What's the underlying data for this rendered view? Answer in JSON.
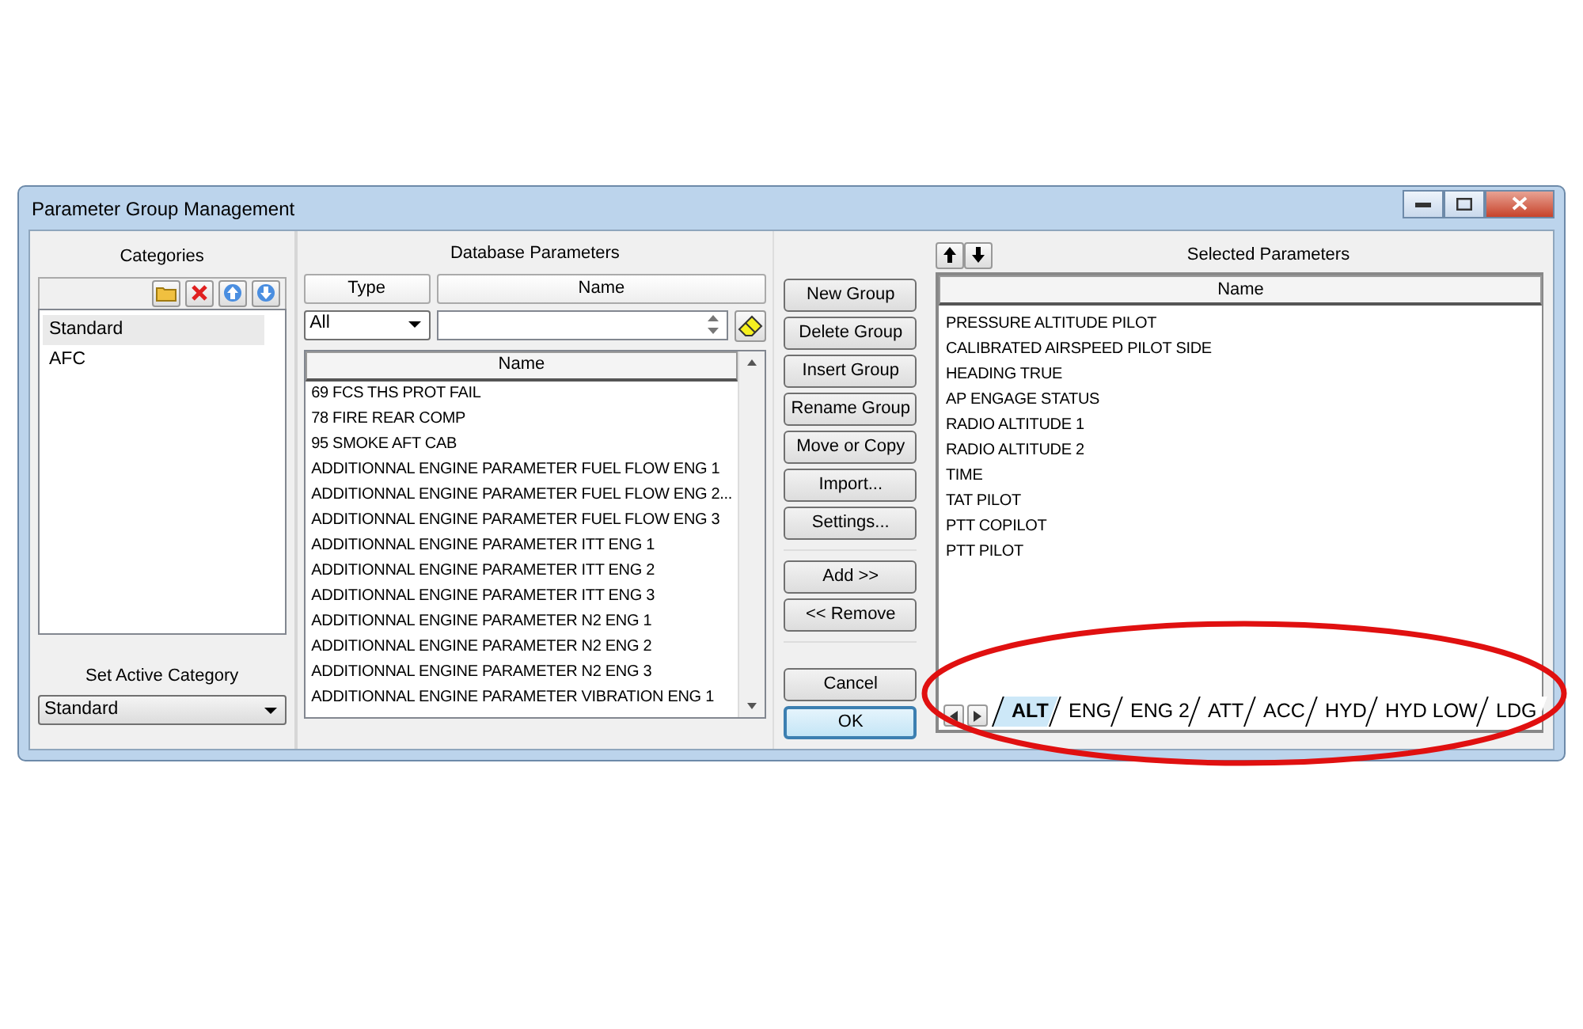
{
  "window": {
    "title": "Parameter Group Management"
  },
  "categories": {
    "title": "Categories",
    "items": [
      {
        "label": "Standard",
        "selected": true
      },
      {
        "label": "AFC",
        "selected": false
      }
    ],
    "active_label": "Set Active Category",
    "active_value": "Standard"
  },
  "database": {
    "title": "Database Parameters",
    "type_header": "Type",
    "type_value": "All",
    "name_header": "Name",
    "list_header": "Name",
    "rows": [
      "69 FCS THS PROT FAIL",
      "78 FIRE REAR COMP",
      "95 SMOKE AFT CAB",
      "ADDITIONNAL ENGINE PARAMETER FUEL FLOW ENG 1",
      "ADDITIONNAL ENGINE PARAMETER FUEL FLOW ENG 2...",
      "ADDITIONNAL ENGINE PARAMETER FUEL FLOW ENG 3",
      "ADDITIONNAL ENGINE PARAMETER ITT ENG 1",
      "ADDITIONNAL ENGINE PARAMETER ITT ENG 2",
      "ADDITIONNAL ENGINE PARAMETER ITT ENG 3",
      "ADDITIONNAL ENGINE PARAMETER N2 ENG 1",
      "ADDITIONNAL ENGINE PARAMETER N2 ENG 2",
      "ADDITIONNAL ENGINE PARAMETER N2 ENG 3",
      "ADDITIONNAL ENGINE PARAMETER VIBRATION ENG 1"
    ]
  },
  "action_groups": [
    [
      {
        "label": "New Group",
        "default": false
      },
      {
        "label": "Delete Group",
        "default": false
      },
      {
        "label": "Insert Group",
        "default": false
      },
      {
        "label": "Rename Group",
        "default": false
      },
      {
        "label": "Move or Copy",
        "default": false
      },
      {
        "label": "Import...",
        "default": false
      },
      {
        "label": "Settings...",
        "default": false
      }
    ],
    [
      {
        "label": "Add  >>",
        "default": false
      },
      {
        "label": "<<  Remove",
        "default": false
      }
    ],
    [
      {
        "label": "Cancel",
        "default": false
      },
      {
        "label": "OK",
        "default": true
      }
    ]
  ],
  "selected": {
    "title": "Selected Parameters",
    "list_header": "Name",
    "rows": [
      "PRESSURE ALTITUDE PILOT",
      "CALIBRATED AIRSPEED PILOT SIDE",
      "HEADING TRUE",
      "AP ENGAGE STATUS",
      "RADIO ALTITUDE 1",
      "RADIO ALTITUDE 2",
      "TIME",
      "TAT PILOT",
      "PTT COPILOT",
      "PTT PILOT"
    ],
    "tabs": [
      {
        "label": "ALT",
        "selected": true
      },
      {
        "label": "ENG",
        "selected": false
      },
      {
        "label": "ENG 2",
        "selected": false
      },
      {
        "label": "ATT",
        "selected": false
      },
      {
        "label": "ACC",
        "selected": false
      },
      {
        "label": "HYD",
        "selected": false
      },
      {
        "label": "HYD LOW",
        "selected": false
      },
      {
        "label": "LDG",
        "selected": false
      }
    ]
  }
}
